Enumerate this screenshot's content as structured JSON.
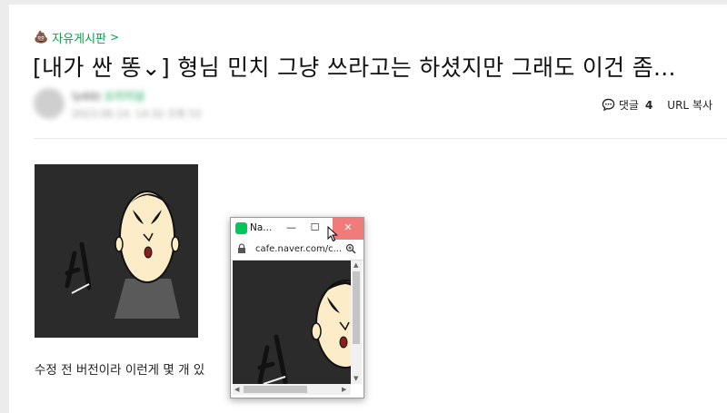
{
  "article": {
    "board_icon": "poop-emoji",
    "board_emoji": "💩",
    "board_name": "자유게시판",
    "board_chevron": ">",
    "title": "[내가 싼 똥⌄] 형님 민치 그냥 쓰라고는 하셨지만 그래도 이건 좀...",
    "author": {
      "name": "lyddz",
      "badge": "오리지널",
      "meta": "2023.06.14. 14:32   조회 52"
    },
    "comments_icon": "comment-bubble-icon",
    "comments_label": "댓글",
    "comments_count": "4",
    "url_copy_label": "URL 복사",
    "image_text": "너",
    "caption": "수정 전 버전이라 이런게 몇 개 있"
  },
  "popup": {
    "favicon": "cafe-green-icon",
    "title": "Na...",
    "minimize": "—",
    "maximize": "☐",
    "close": "✕",
    "lock_icon": "lock-icon",
    "address": "cafe.naver.com/c...",
    "zoom_icon": "zoom-icon",
    "image_text": "너"
  },
  "colors": {
    "accent_green": "#03a44a",
    "close_button": "#ef7b7b",
    "image_background": "#2b2b2b"
  }
}
